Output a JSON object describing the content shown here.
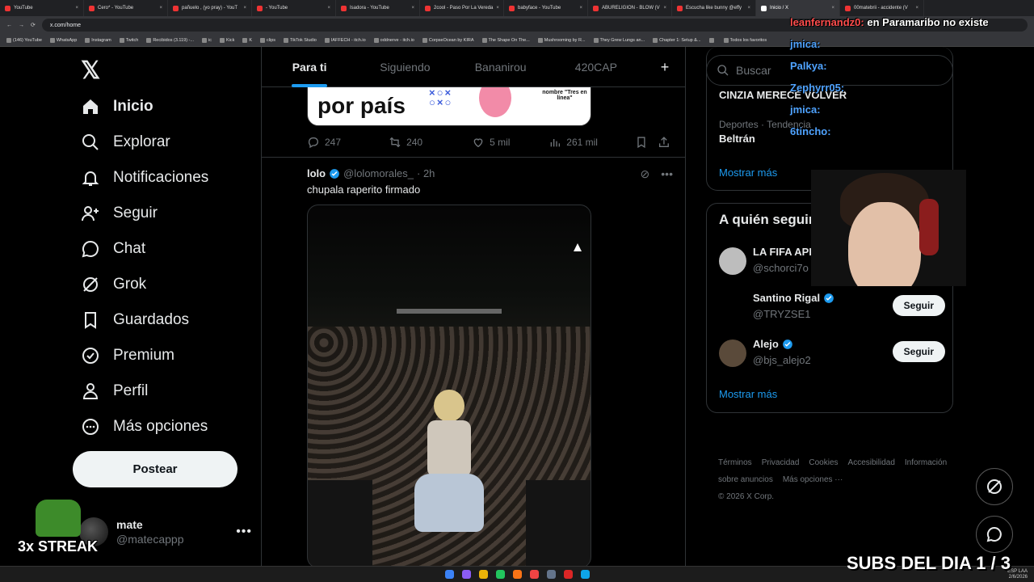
{
  "browser": {
    "tabs": [
      {
        "label": "YouTube"
      },
      {
        "label": "Cero* - YouTube"
      },
      {
        "label": "pañuelo , (yo pray) - YouT"
      },
      {
        "label": "- YouTube"
      },
      {
        "label": "Isadora - YouTube"
      },
      {
        "label": "2cool - Paso Por La Vereda"
      },
      {
        "label": "babyface - YouTube"
      },
      {
        "label": "ABURELIGION - BLOW (V"
      },
      {
        "label": "Escucha like bunny @effy"
      },
      {
        "label": "Inicio / X",
        "active": true
      },
      {
        "label": "00matebrii - accidente (V"
      }
    ],
    "url": "x.com/home",
    "bookmarks": [
      "(146) YouTube",
      "WhatsApp",
      "Instagram",
      "Twitch",
      "Recibidos (3.119) -...",
      "ic",
      "Kick",
      "K",
      "clips",
      "TikTok Studio",
      "IAFFECH - itch.io",
      "oddnerve - itch.io",
      "CorpseOcean by KIRA",
      "The Shape On The...",
      "Mushrooming by R...",
      "They Grew Lungs an...",
      "Chapter 1: Setup &...",
      "",
      "Todos los favoritos"
    ]
  },
  "nav": {
    "items": [
      {
        "label": "Inicio",
        "icon": "home-icon"
      },
      {
        "label": "Explorar",
        "icon": "search-icon"
      },
      {
        "label": "Notificaciones",
        "icon": "bell-icon"
      },
      {
        "label": "Seguir",
        "icon": "add-user-icon"
      },
      {
        "label": "Chat",
        "icon": "chat-icon"
      },
      {
        "label": "Grok",
        "icon": "grok-icon"
      },
      {
        "label": "Guardados",
        "icon": "bookmark-icon"
      },
      {
        "label": "Premium",
        "icon": "verified-icon"
      },
      {
        "label": "Perfil",
        "icon": "person-icon"
      },
      {
        "label": "Más opciones",
        "icon": "more-circle-icon"
      }
    ],
    "post_label": "Postear",
    "account": {
      "name": "mate",
      "handle": "@matecappp"
    }
  },
  "feed": {
    "tabs": [
      "Para ti",
      "Siguiendo",
      "Bananirou",
      "420CAP",
      "+"
    ],
    "promo": {
      "text": "por país",
      "sub": "nombre \"Tres en línea\""
    },
    "prev_actions": {
      "replies": "247",
      "reposts": "240",
      "likes": "5 mil",
      "views": "261 mil"
    },
    "tweet": {
      "name": "lolo",
      "handle": "@lolomorales_",
      "time": "· 2h",
      "text": "chupala raperito firmado"
    }
  },
  "sidebar": {
    "search_placeholder": "Buscar",
    "trend_top": "CINZIA MERECE VOLVER",
    "trend_category": "Deportes · Tendencia",
    "trend_name": "Beltrán",
    "show_more": "Mostrar más",
    "who_title": "A quién seguir",
    "who": [
      {
        "name": "LA FIFA APRETO A ZU",
        "handle": "@schorci7o",
        "verified": false
      },
      {
        "name": "Santino Rigal",
        "handle": "@TRYZSE1",
        "verified": true
      },
      {
        "name": "Alejo",
        "handle": "@bjs_alejo2",
        "verified": true
      }
    ],
    "follow_label": "Seguir",
    "footer_links": [
      "Términos",
      "Privacidad",
      "Cookies",
      "Accesibilidad",
      "Información sobre anuncios",
      "Más opciones ···"
    ],
    "copyright": "© 2026 X Corp."
  },
  "overlay": {
    "chat": [
      {
        "user": "leanfernandz0:",
        "msg": "en Paramaribo no existe",
        "color": "red"
      },
      {
        "user": "jmica:",
        "msg": ""
      },
      {
        "user": "Palkya:",
        "msg": ""
      },
      {
        "user": "Zephyrr05:",
        "msg": ""
      },
      {
        "user": "jmica:",
        "msg": ""
      },
      {
        "user": "6tincho:",
        "msg": ""
      }
    ],
    "streak": "3x STREAK",
    "subs": "SUBS DEL DIA 1 / 3"
  },
  "taskbar": {
    "lang": "ESP LAA",
    "date": "2/6/2026"
  },
  "colors": {
    "accent": "#1d9bf0",
    "bg": "#000000",
    "text": "#e7e9ea",
    "muted": "#71767b"
  }
}
